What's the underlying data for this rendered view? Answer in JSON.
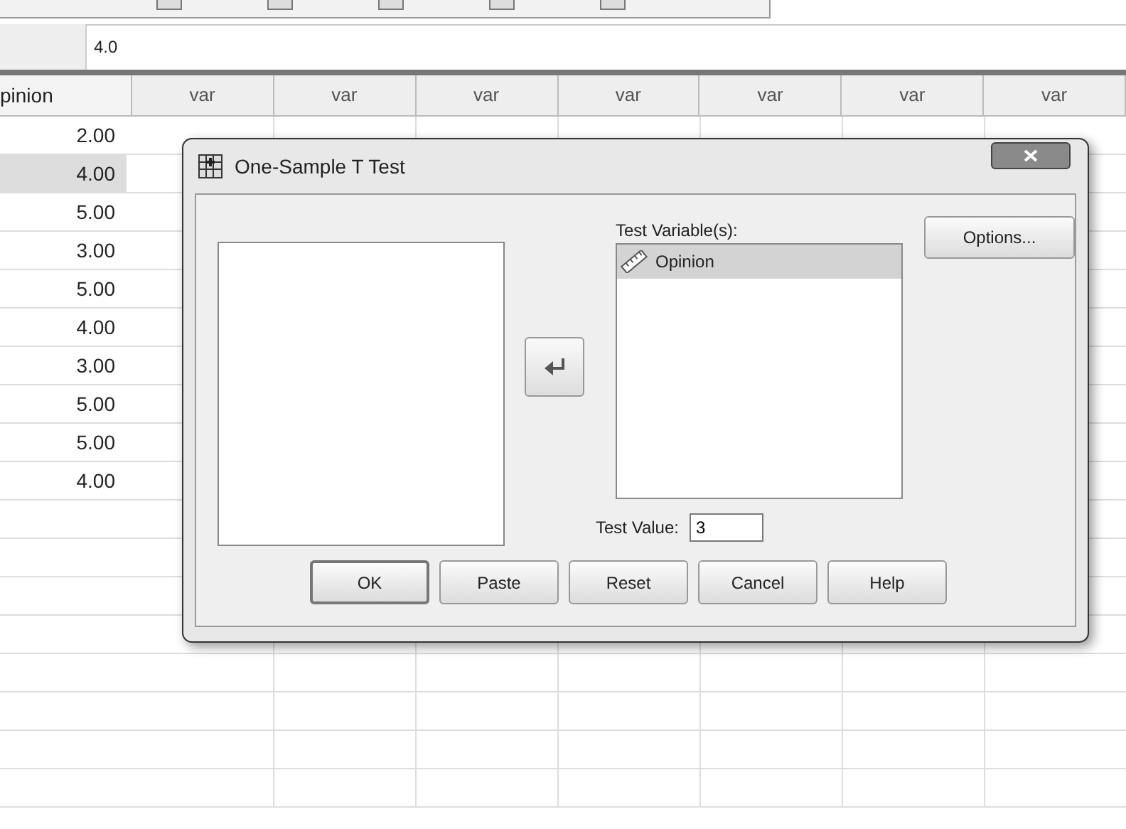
{
  "cell_editor": {
    "value": "4.0"
  },
  "grid": {
    "columns": [
      "pinion",
      "var",
      "var",
      "var",
      "var",
      "var",
      "var",
      "var"
    ],
    "rows": [
      {
        "opinion": "2.00",
        "selected": false
      },
      {
        "opinion": "4.00",
        "selected": true
      },
      {
        "opinion": "5.00",
        "selected": false
      },
      {
        "opinion": "3.00",
        "selected": false
      },
      {
        "opinion": "5.00",
        "selected": false
      },
      {
        "opinion": "4.00",
        "selected": false
      },
      {
        "opinion": "3.00",
        "selected": false
      },
      {
        "opinion": "5.00",
        "selected": false
      },
      {
        "opinion": "5.00",
        "selected": false
      },
      {
        "opinion": "4.00",
        "selected": false
      }
    ]
  },
  "dialog": {
    "title": "One-Sample T Test",
    "test_variables_label": "Test Variable(s):",
    "test_variables": [
      {
        "label": "Opinion",
        "selected": true
      }
    ],
    "options_button": "Options...",
    "test_value_label": "Test Value:",
    "test_value": "3",
    "buttons": [
      {
        "label": "OK",
        "default": true
      },
      {
        "label": "Paste",
        "default": false
      },
      {
        "label": "Reset",
        "default": false
      },
      {
        "label": "Cancel",
        "default": false
      },
      {
        "label": "Help",
        "default": false
      }
    ]
  }
}
